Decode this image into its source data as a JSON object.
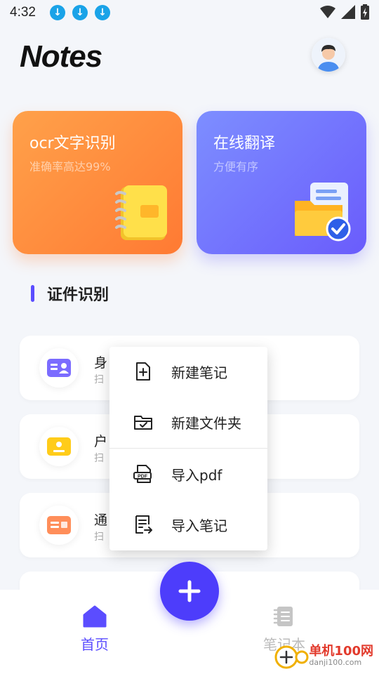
{
  "status_bar": {
    "time": "4:32",
    "notification_icons": [
      "download-icon",
      "download-icon",
      "download-icon"
    ],
    "right_icons": [
      "wifi-icon",
      "signal-icon",
      "battery-charging-icon"
    ]
  },
  "header": {
    "title": "Notes",
    "avatar": "user-avatar"
  },
  "feature_cards": [
    {
      "title": "ocr文字识别",
      "subtitle": "准确率高达99%",
      "color": "#ff8a3d",
      "icon": "notebook-icon"
    },
    {
      "title": "在线翻译",
      "subtitle": "方便有序",
      "color": "#7470fd",
      "icon": "folder-check-icon"
    }
  ],
  "section": {
    "title": "证件识别",
    "accent": "#5b4dff"
  },
  "list_items": [
    {
      "title": "身",
      "subtitle": "扫",
      "icon": "id-card-icon",
      "color": "#7b6cff"
    },
    {
      "title": "户",
      "subtitle": "扫",
      "icon": "household-register-icon",
      "color": "#ffcc1a"
    },
    {
      "title": "通",
      "subtitle": "扫",
      "icon": "pass-card-icon",
      "color": "#ff8e5a"
    },
    {
      "title": "",
      "subtitle": "",
      "icon": "document-icon",
      "color": "#cccccc"
    }
  ],
  "popup_menu": {
    "items": [
      {
        "label": "新建笔记",
        "icon": "new-note-icon"
      },
      {
        "label": "新建文件夹",
        "icon": "new-folder-icon"
      },
      {
        "label": "导入pdf",
        "icon": "import-pdf-icon"
      },
      {
        "label": "导入笔记",
        "icon": "import-note-icon"
      }
    ]
  },
  "fab": {
    "icon": "plus-icon",
    "color": "#4d3dfb"
  },
  "bottom_nav": {
    "home_label": "首页",
    "notes_label": "笔记本",
    "active_color": "#5b4dff"
  },
  "watermark": {
    "name": "单机100网",
    "url": "danji100.com"
  }
}
